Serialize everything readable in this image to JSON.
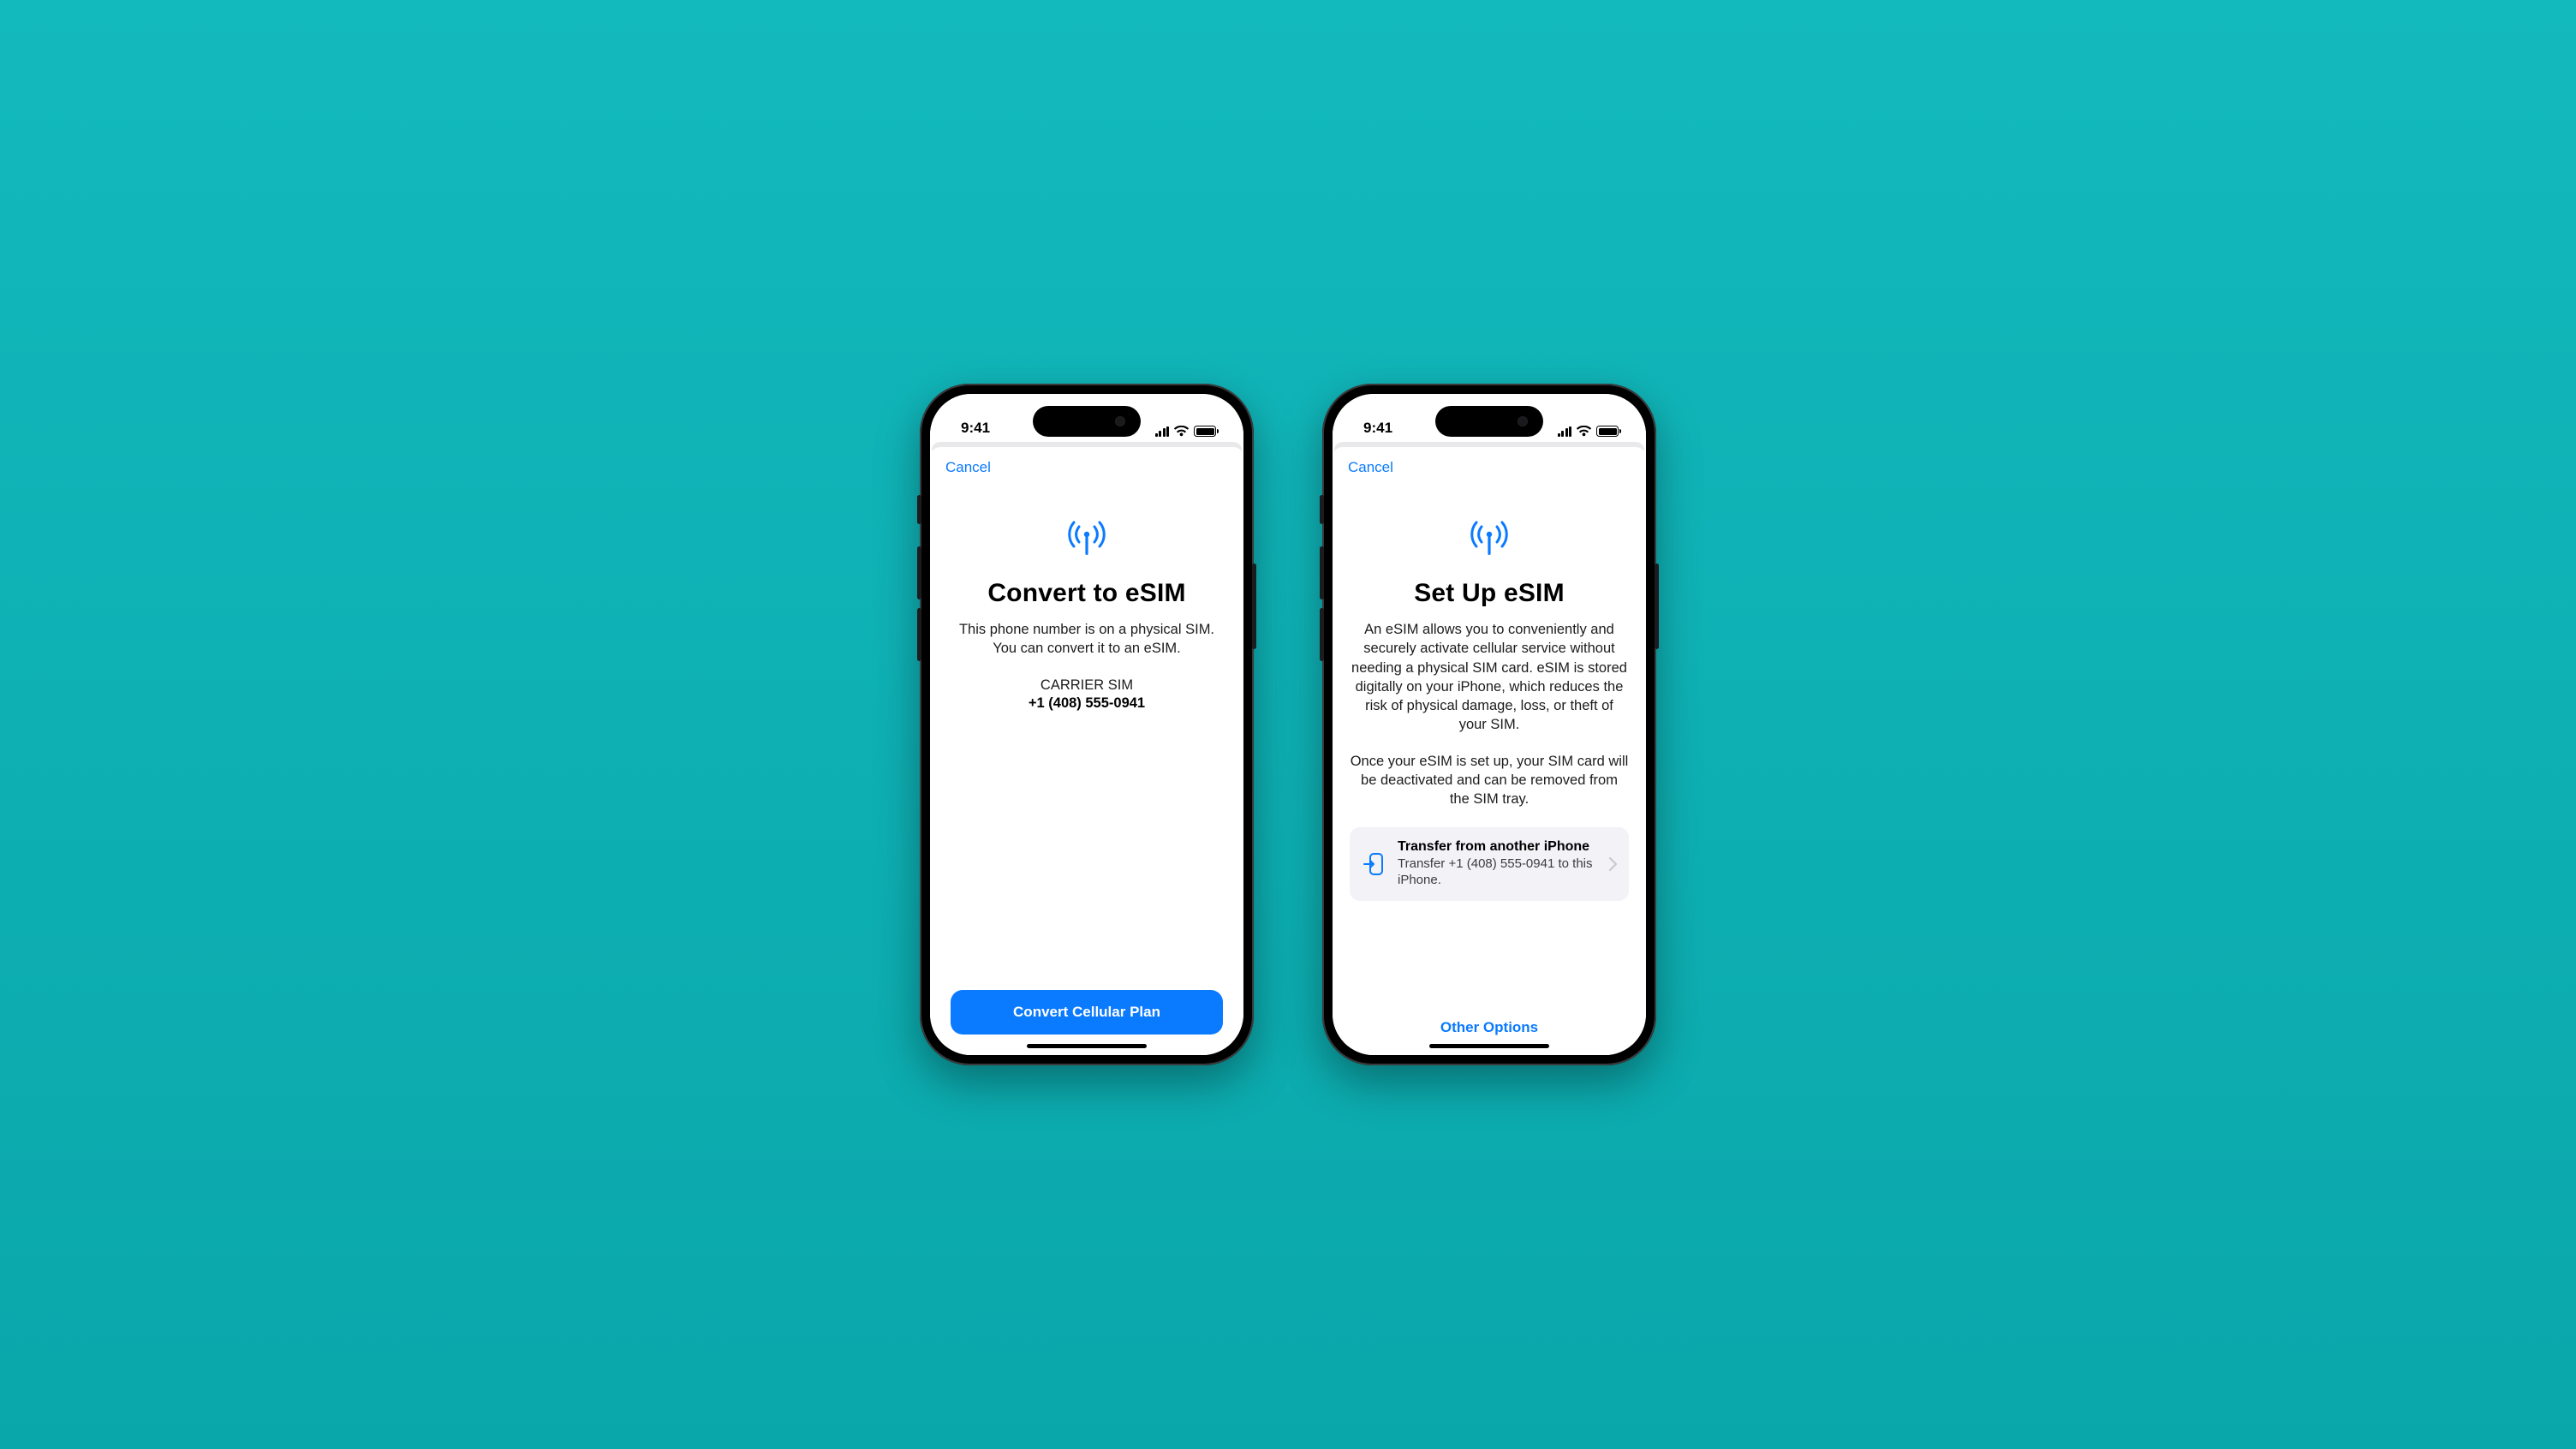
{
  "status": {
    "time": "9:41"
  },
  "left": {
    "cancel": "Cancel",
    "title": "Convert to eSIM",
    "body": "This phone number is on a physical SIM. You can convert it to an eSIM.",
    "carrier_label": "CARRIER SIM",
    "phone_number": "+1 (408) 555-0941",
    "primary_button": "Convert Cellular Plan"
  },
  "right": {
    "cancel": "Cancel",
    "title": "Set Up eSIM",
    "body1": "An eSIM allows you to conveniently and securely activate cellular service without needing a physical SIM card. eSIM is stored digitally on your iPhone, which reduces the risk of physical damage, loss, or theft of your SIM.",
    "body2": "Once your eSIM is set up, your SIM card will be deactivated and can be removed from the SIM tray.",
    "cell": {
      "title": "Transfer from another iPhone",
      "subtitle": "Transfer +1 (408) 555-0941 to this iPhone."
    },
    "other_options": "Other Options"
  }
}
